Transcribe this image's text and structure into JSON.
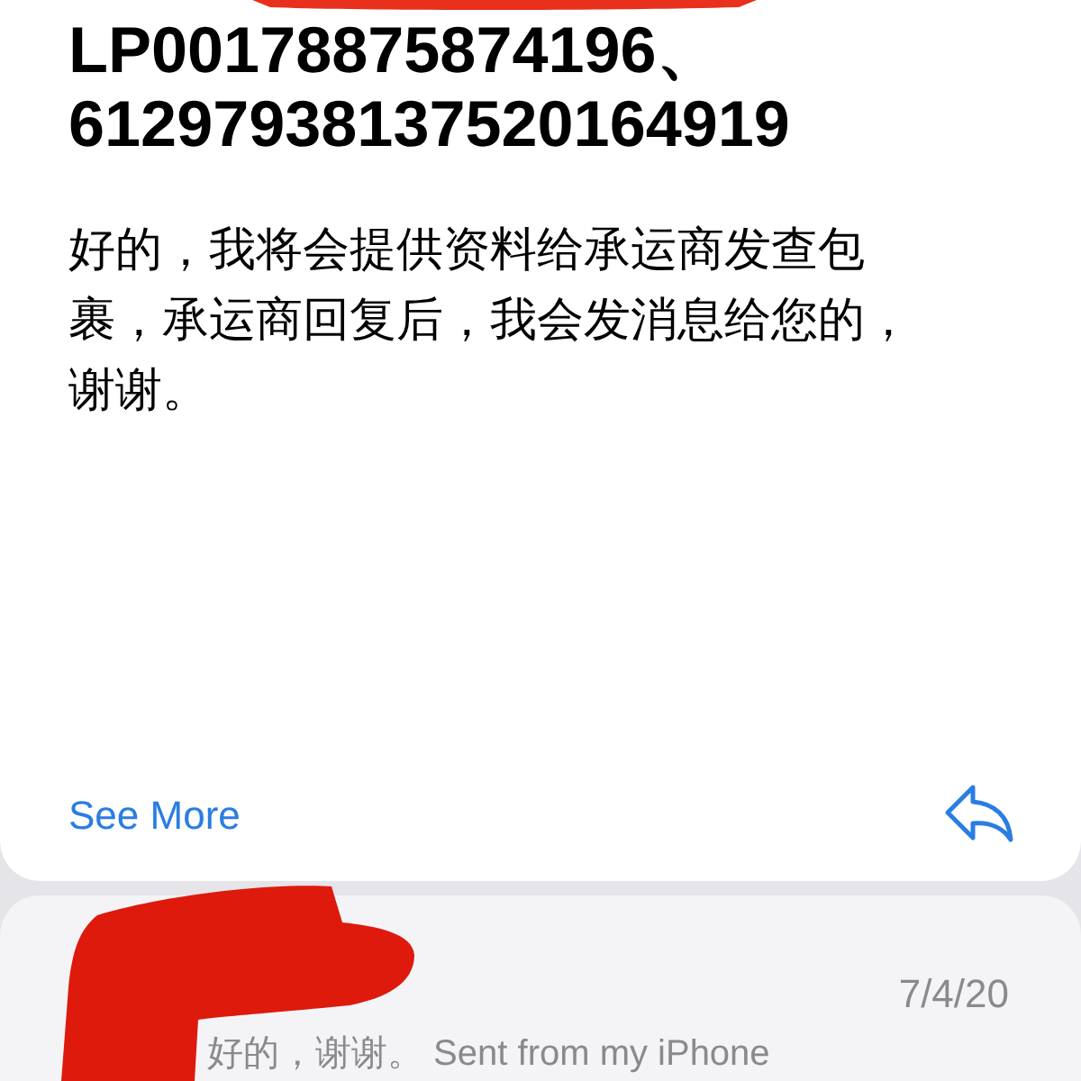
{
  "message": {
    "tracking_lines": [
      "LP00178875874196、",
      "61297938137520164919"
    ],
    "body_lines": [
      "好的，我将会提供资料给承运商发查包",
      "裹，承运商回复后，我会发消息给您的，",
      "谢谢。"
    ],
    "see_more": "See More"
  },
  "next_message": {
    "date": "7/4/20",
    "preview": "好的，谢谢。 Sent from my iPhone"
  }
}
